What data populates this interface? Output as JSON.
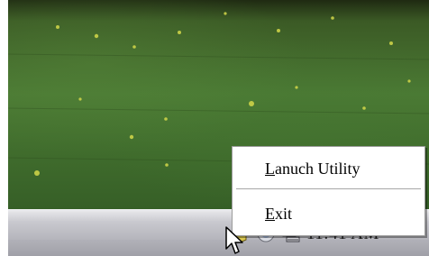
{
  "context_menu": {
    "items": [
      {
        "mnemonic": "L",
        "rest": "anuch Utility"
      },
      {
        "mnemonic": "E",
        "rest": "xit"
      }
    ]
  },
  "taskbar": {
    "clock": "11:41 AM"
  },
  "icons": {
    "tray": [
      "utility-tray-icon",
      "cd-drive-icon",
      "network-icon"
    ],
    "pointer": "mouse-cursor-icon"
  },
  "colors": {
    "menu_background": "#ffffff",
    "menu_border": "#9b9b9b",
    "taskbar": "#b6b6bd",
    "wallpaper_grass": "#4b7a34"
  }
}
